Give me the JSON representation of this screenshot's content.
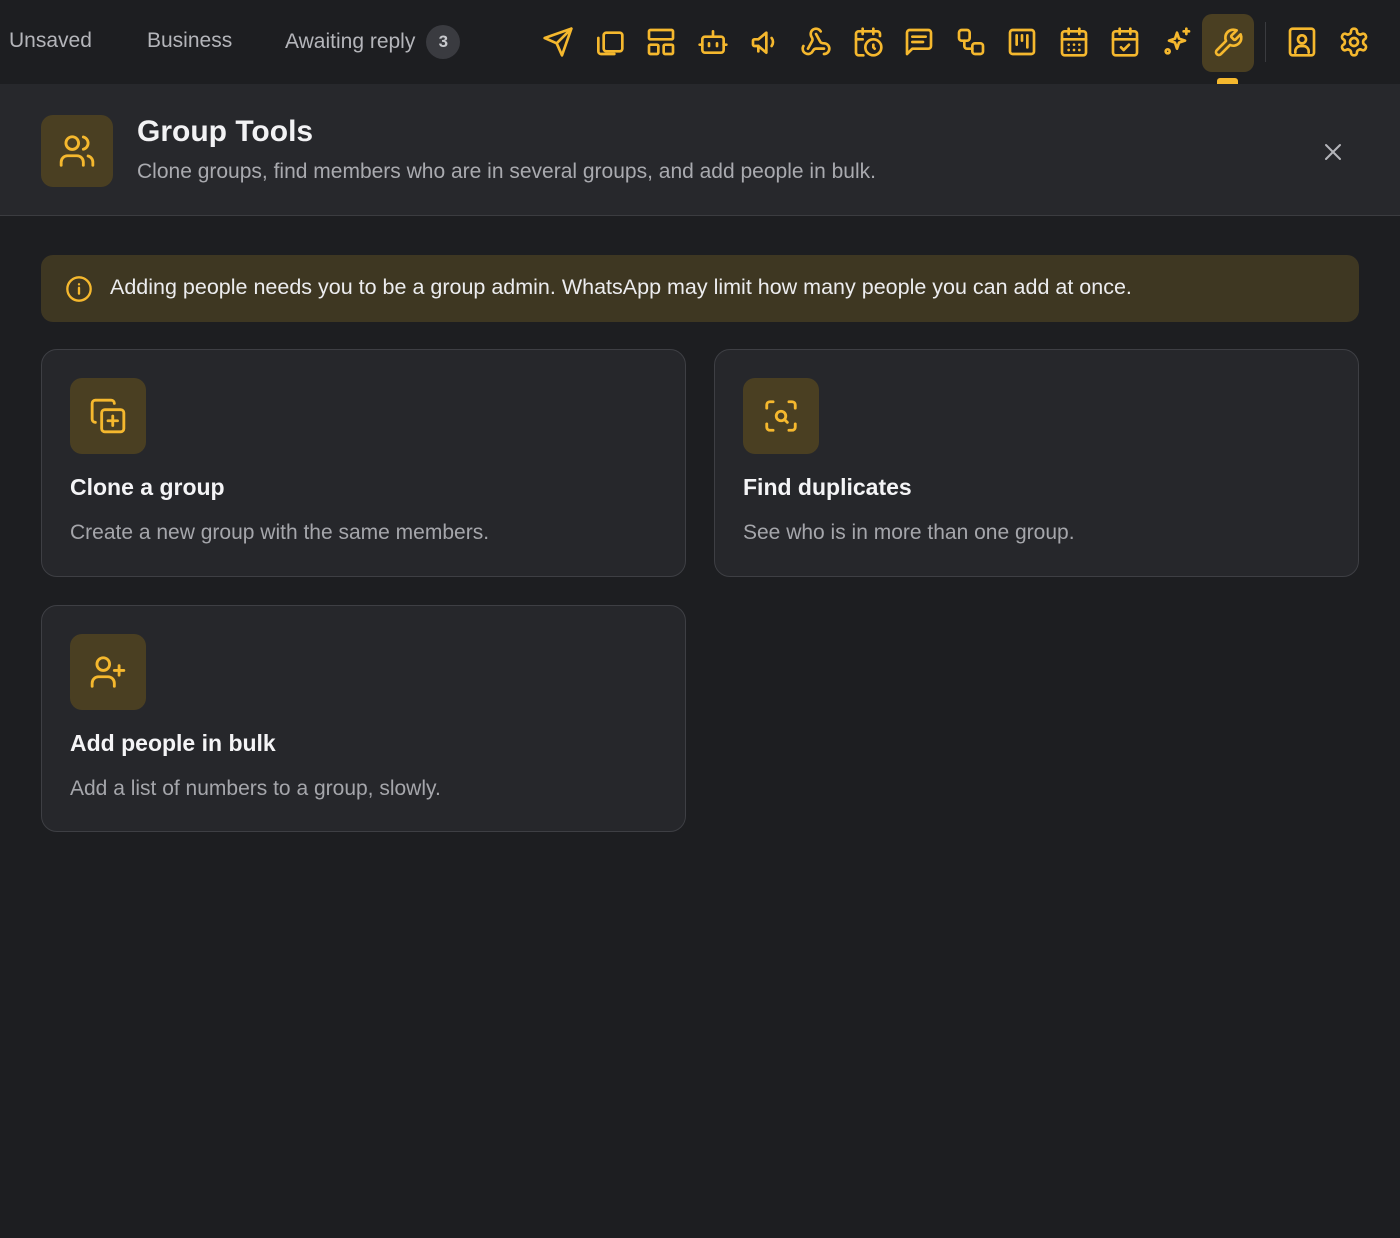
{
  "topbar": {
    "filters": [
      {
        "label": "Unsaved"
      },
      {
        "label": "Business"
      },
      {
        "label": "Awaiting reply",
        "count": "3"
      }
    ],
    "tools": [
      {
        "icon": "send-icon"
      },
      {
        "icon": "copy-icon"
      },
      {
        "icon": "layout-icon"
      },
      {
        "icon": "bot-icon"
      },
      {
        "icon": "megaphone-icon"
      },
      {
        "icon": "webhook-icon"
      },
      {
        "icon": "calendar-clock-icon"
      },
      {
        "icon": "message-square-icon"
      },
      {
        "icon": "workflow-icon"
      },
      {
        "icon": "kanban-icon"
      },
      {
        "icon": "calendar-grid-icon"
      },
      {
        "icon": "calendar-check-icon"
      },
      {
        "icon": "sparkles-icon"
      },
      {
        "icon": "wrench-icon",
        "active": true
      },
      {
        "icon": "contact-icon"
      },
      {
        "icon": "settings-icon"
      }
    ],
    "accent_color": "#f5b82e"
  },
  "panel": {
    "icon": "users-icon",
    "title": "Group Tools",
    "subtitle": "Clone groups, find members who are in several groups, and add people in bulk."
  },
  "notice": {
    "icon": "info-icon",
    "text": "Adding people needs you to be a group admin. WhatsApp may limit how many people you can add at once."
  },
  "cards": [
    {
      "icon": "copy-plus-icon",
      "title": "Clone a group",
      "description": "Create a new group with the same members."
    },
    {
      "icon": "scan-search-icon",
      "title": "Find duplicates",
      "description": "See who is in more than one group."
    },
    {
      "icon": "user-plus-icon",
      "title": "Add people in bulk",
      "description": "Add a list of numbers to a group, slowly."
    }
  ]
}
